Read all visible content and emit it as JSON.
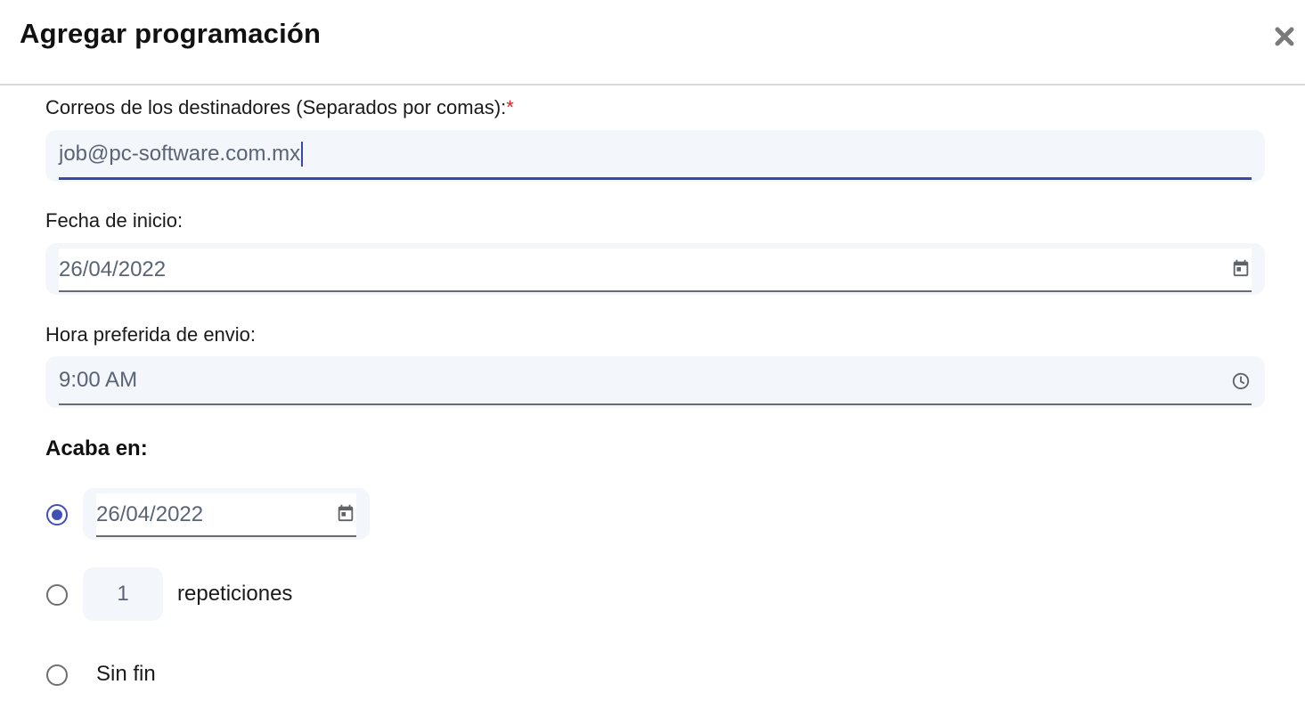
{
  "dialog": {
    "title": "Agregar programación"
  },
  "fields": {
    "recipients": {
      "label": "Correos de los destinadores (Separados por comas):",
      "required_mark": "*",
      "value": "job@pc-software.com.mx"
    },
    "start_date": {
      "label": "Fecha de inicio:",
      "value": "26/04/2022",
      "icon": "calendar-icon"
    },
    "send_time": {
      "label": "Hora preferida de envio:",
      "value": "9:00 AM",
      "icon": "clock-icon"
    }
  },
  "ends": {
    "heading": "Acaba en:",
    "options": [
      {
        "type": "date",
        "checked": true,
        "value": "26/04/2022",
        "icon": "calendar-icon"
      },
      {
        "type": "repetitions",
        "checked": false,
        "value": "1",
        "suffix": "repeticiones"
      },
      {
        "type": "never",
        "checked": false,
        "label": "Sin fin"
      }
    ]
  },
  "colors": {
    "accent": "#3f51b5",
    "input_bg": "#f3f6fa",
    "required": "#e02020"
  }
}
